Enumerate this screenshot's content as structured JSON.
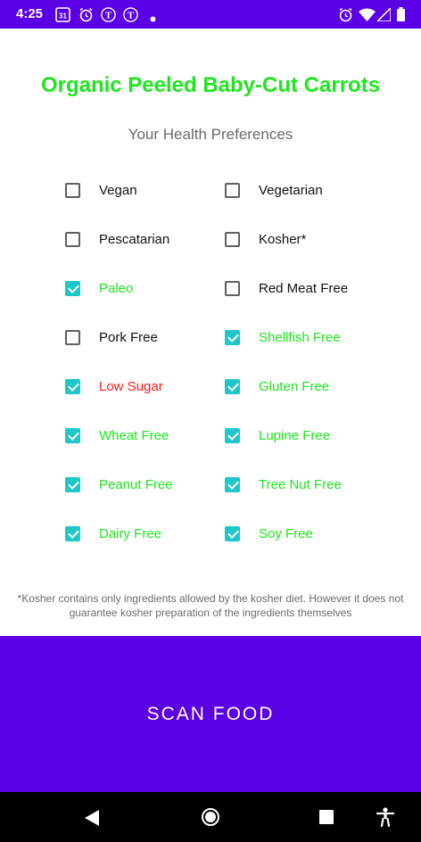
{
  "status_bar": {
    "time": "4:25",
    "left_icons": [
      "calendar-icon",
      "alarm-icon",
      "nytimes-icon",
      "nytimes-icon",
      "dot-icon"
    ],
    "right_icons": [
      "alarm-icon",
      "wifi-icon",
      "signal-icon",
      "battery-icon"
    ],
    "calendar_day": "31",
    "nyt_glyph": "T",
    "color": "#5b00e6"
  },
  "product": {
    "title": "Organic Peeled Baby-Cut Carrots"
  },
  "preferences": {
    "heading": "Your Health Preferences",
    "items": [
      {
        "label": "Vegan",
        "checked": false,
        "status": "none"
      },
      {
        "label": "Vegetarian",
        "checked": false,
        "status": "none"
      },
      {
        "label": "Pescatarian",
        "checked": false,
        "status": "none"
      },
      {
        "label": "Kosher*",
        "checked": false,
        "status": "none"
      },
      {
        "label": "Paleo",
        "checked": true,
        "status": "ok"
      },
      {
        "label": "Red Meat Free",
        "checked": false,
        "status": "none"
      },
      {
        "label": "Pork Free",
        "checked": false,
        "status": "none"
      },
      {
        "label": "Shellfish Free",
        "checked": true,
        "status": "ok"
      },
      {
        "label": "Low Sugar",
        "checked": true,
        "status": "fail"
      },
      {
        "label": "Gluten Free",
        "checked": true,
        "status": "ok"
      },
      {
        "label": "Wheat Free",
        "checked": true,
        "status": "ok"
      },
      {
        "label": "Lupine Free",
        "checked": true,
        "status": "ok"
      },
      {
        "label": "Peanut Free",
        "checked": true,
        "status": "ok"
      },
      {
        "label": "Tree Nut Free",
        "checked": true,
        "status": "ok"
      },
      {
        "label": "Dairy Free",
        "checked": true,
        "status": "ok"
      },
      {
        "label": "Soy Free",
        "checked": true,
        "status": "ok"
      }
    ]
  },
  "footnote": "*Kosher contains only ingredients allowed by the kosher diet. However it does not guarantee kosher preparation of the ingredients themselves",
  "scan_button": {
    "label": "SCAN FOOD"
  },
  "nav_bar": {
    "icons": [
      "back-icon",
      "home-icon",
      "recents-icon",
      "accessibility-icon"
    ]
  },
  "colors": {
    "accent": "#5b00e6",
    "title": "#1ee61e",
    "ok": "#1ee61e",
    "fail": "#ff1a1a",
    "none": "#111111",
    "checkbox": "#1ec8c8"
  }
}
